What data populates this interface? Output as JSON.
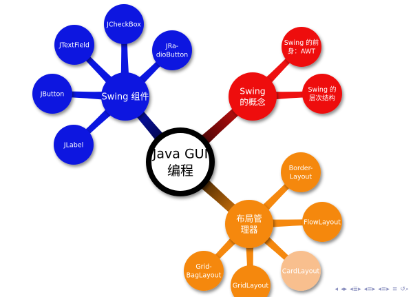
{
  "center": {
    "line1": "Java GUI",
    "line2": "编程"
  },
  "branches": [
    {
      "id": "swing-components",
      "color": "#0b16e0",
      "label_lines": [
        "Swing 组件"
      ],
      "children": [
        {
          "id": "jcheckbox",
          "label_lines": [
            "JCheckBox"
          ]
        },
        {
          "id": "jradiobutton",
          "label_lines": [
            "JRa-",
            "dioButton"
          ]
        },
        {
          "id": "jtextfield",
          "label_lines": [
            "JTextField"
          ]
        },
        {
          "id": "jbutton",
          "label_lines": [
            "JButton"
          ]
        },
        {
          "id": "jlabel",
          "label_lines": [
            "JLabel"
          ]
        }
      ]
    },
    {
      "id": "swing-concept",
      "color": "#ee1111",
      "label_lines": [
        "Swing",
        "的概念"
      ],
      "children": [
        {
          "id": "swing-predecessor",
          "label_lines": [
            "Swing 的前",
            "身：AWT"
          ]
        },
        {
          "id": "swing-hierarchy",
          "label_lines": [
            "Swing 的",
            "层次结构"
          ]
        }
      ]
    },
    {
      "id": "layout-managers",
      "color": "#f5880e",
      "label_lines": [
        "布局管",
        "理器"
      ],
      "children": [
        {
          "id": "borderlayout",
          "label_lines": [
            "Border-",
            "Layout"
          ]
        },
        {
          "id": "flowlayout",
          "label_lines": [
            "FlowLayout"
          ]
        },
        {
          "id": "cardlayout",
          "label_lines": [
            "CardLayout"
          ],
          "color": "#f8bf8e"
        },
        {
          "id": "gridlayout",
          "label_lines": [
            "GridLayout"
          ]
        },
        {
          "id": "gridbaglayout",
          "label_lines": [
            "Grid-",
            "BagLayout"
          ]
        }
      ]
    }
  ],
  "nav_icons": [
    {
      "name": "nav-first-icon",
      "glyph": "◂"
    },
    {
      "name": "nav-prev-frame-icon",
      "glyph": "◂▸"
    },
    {
      "name": "nav-prev-section-icon",
      "glyph": "◂≣▸"
    },
    {
      "name": "nav-section-icon",
      "glyph": "◂≡▸"
    },
    {
      "name": "nav-subsection-icon",
      "glyph": "◂≡▸"
    },
    {
      "name": "nav-align-icon",
      "glyph": "≡"
    },
    {
      "name": "nav-search-icon",
      "glyph": "↺⌕"
    }
  ]
}
